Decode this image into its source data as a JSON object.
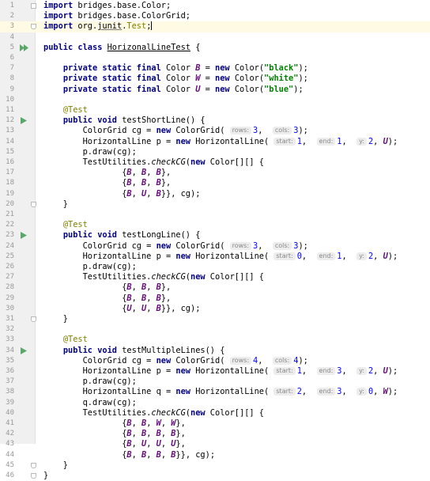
{
  "editor": {
    "language": "java",
    "current_line": 3,
    "colors": {
      "keyword": "#000080",
      "string": "#008000",
      "annotation": "#808000",
      "field": "#660e7a",
      "number": "#0000ff",
      "line_number": "#999999",
      "gutter_bg": "#f0f0f0",
      "current_line_bg": "#fffae3",
      "run_icon": "#59a869"
    },
    "lines": [
      {
        "n": "1",
        "icon": "fold",
        "tokens": [
          {
            "t": "import",
            "c": "kw"
          },
          {
            "t": " bridges.base.Color;"
          }
        ]
      },
      {
        "n": "2",
        "tokens": [
          {
            "t": "import",
            "c": "kw"
          },
          {
            "t": " bridges.base.ColorGrid;"
          }
        ]
      },
      {
        "n": "3",
        "icon": "fold-end",
        "tokens": [
          {
            "t": "import",
            "c": "kw"
          },
          {
            "t": " org."
          },
          {
            "t": "junit",
            "c": "junit-u"
          },
          {
            "t": "."
          },
          {
            "t": "Test",
            "c": "ann"
          },
          {
            "t": ";"
          }
        ]
      },
      {
        "n": "4",
        "tokens": []
      },
      {
        "n": "5",
        "icon": "run-double",
        "tokens": [
          {
            "t": "public class",
            "c": "kw"
          },
          {
            "t": " "
          },
          {
            "t": "HorizonalLineTest",
            "c": "cls-u"
          },
          {
            "t": " {"
          }
        ]
      },
      {
        "n": "6",
        "tokens": []
      },
      {
        "n": "7",
        "tokens": [
          {
            "t": "    "
          },
          {
            "t": "private static final",
            "c": "kw"
          },
          {
            "t": " Color "
          },
          {
            "t": "B",
            "c": "fld"
          },
          {
            "t": " = "
          },
          {
            "t": "new",
            "c": "kw"
          },
          {
            "t": " Color("
          },
          {
            "t": "\"black\"",
            "c": "str"
          },
          {
            "t": ");"
          }
        ]
      },
      {
        "n": "8",
        "tokens": [
          {
            "t": "    "
          },
          {
            "t": "private static final",
            "c": "kw"
          },
          {
            "t": " Color "
          },
          {
            "t": "W",
            "c": "fld"
          },
          {
            "t": " = "
          },
          {
            "t": "new",
            "c": "kw"
          },
          {
            "t": " Color("
          },
          {
            "t": "\"white\"",
            "c": "str"
          },
          {
            "t": ");"
          }
        ]
      },
      {
        "n": "9",
        "tokens": [
          {
            "t": "    "
          },
          {
            "t": "private static final",
            "c": "kw"
          },
          {
            "t": " Color "
          },
          {
            "t": "U",
            "c": "fld"
          },
          {
            "t": " = "
          },
          {
            "t": "new",
            "c": "kw"
          },
          {
            "t": " Color("
          },
          {
            "t": "\"blue\"",
            "c": "str"
          },
          {
            "t": ");"
          }
        ]
      },
      {
        "n": "10",
        "tokens": []
      },
      {
        "n": "11",
        "tokens": [
          {
            "t": "    "
          },
          {
            "t": "@Test",
            "c": "ann"
          }
        ]
      },
      {
        "n": "12",
        "icon": "run",
        "tokens": [
          {
            "t": "    "
          },
          {
            "t": "public void",
            "c": "kw"
          },
          {
            "t": " testShortLine() {"
          }
        ]
      },
      {
        "n": "13",
        "tokens": [
          {
            "t": "        ColorGrid cg = "
          },
          {
            "t": "new",
            "c": "kw"
          },
          {
            "t": " ColorGrid( "
          },
          {
            "t": "rows:",
            "c": "hint"
          },
          {
            "t": "3",
            "c": "num"
          },
          {
            "t": ",  "
          },
          {
            "t": "cols:",
            "c": "hint"
          },
          {
            "t": "3",
            "c": "num"
          },
          {
            "t": ");"
          }
        ]
      },
      {
        "n": "14",
        "tokens": [
          {
            "t": "        HorizontalLine p = "
          },
          {
            "t": "new",
            "c": "kw"
          },
          {
            "t": " HorizontalLine( "
          },
          {
            "t": "start:",
            "c": "hint"
          },
          {
            "t": "1",
            "c": "num"
          },
          {
            "t": ",  "
          },
          {
            "t": "end:",
            "c": "hint"
          },
          {
            "t": "1",
            "c": "num"
          },
          {
            "t": ",  "
          },
          {
            "t": "y:",
            "c": "hint"
          },
          {
            "t": "2",
            "c": "num"
          },
          {
            "t": ", "
          },
          {
            "t": "U",
            "c": "fld"
          },
          {
            "t": ");"
          }
        ]
      },
      {
        "n": "15",
        "tokens": [
          {
            "t": "        p.draw(cg);"
          }
        ]
      },
      {
        "n": "16",
        "tokens": [
          {
            "t": "        TestUtilities."
          },
          {
            "t": "checkCG",
            "c": "stm"
          },
          {
            "t": "("
          },
          {
            "t": "new",
            "c": "kw"
          },
          {
            "t": " Color[][] {"
          }
        ]
      },
      {
        "n": "17",
        "tokens": [
          {
            "t": "                {"
          },
          {
            "t": "B",
            "c": "fld"
          },
          {
            "t": ", "
          },
          {
            "t": "B",
            "c": "fld"
          },
          {
            "t": ", "
          },
          {
            "t": "B",
            "c": "fld"
          },
          {
            "t": "},"
          }
        ]
      },
      {
        "n": "18",
        "tokens": [
          {
            "t": "                {"
          },
          {
            "t": "B",
            "c": "fld"
          },
          {
            "t": ", "
          },
          {
            "t": "B",
            "c": "fld"
          },
          {
            "t": ", "
          },
          {
            "t": "B",
            "c": "fld"
          },
          {
            "t": "},"
          }
        ]
      },
      {
        "n": "19",
        "tokens": [
          {
            "t": "                {"
          },
          {
            "t": "B",
            "c": "fld"
          },
          {
            "t": ", "
          },
          {
            "t": "U",
            "c": "fld"
          },
          {
            "t": ", "
          },
          {
            "t": "B",
            "c": "fld"
          },
          {
            "t": "}}, cg);"
          }
        ]
      },
      {
        "n": "20",
        "icon": "fold-end",
        "tokens": [
          {
            "t": "    }"
          }
        ]
      },
      {
        "n": "21",
        "tokens": []
      },
      {
        "n": "22",
        "tokens": [
          {
            "t": "    "
          },
          {
            "t": "@Test",
            "c": "ann"
          }
        ]
      },
      {
        "n": "23",
        "icon": "run",
        "tokens": [
          {
            "t": "    "
          },
          {
            "t": "public void",
            "c": "kw"
          },
          {
            "t": " testLongLine() {"
          }
        ]
      },
      {
        "n": "24",
        "tokens": [
          {
            "t": "        ColorGrid cg = "
          },
          {
            "t": "new",
            "c": "kw"
          },
          {
            "t": " ColorGrid( "
          },
          {
            "t": "rows:",
            "c": "hint"
          },
          {
            "t": "3",
            "c": "num"
          },
          {
            "t": ",  "
          },
          {
            "t": "cols:",
            "c": "hint"
          },
          {
            "t": "3",
            "c": "num"
          },
          {
            "t": ");"
          }
        ]
      },
      {
        "n": "25",
        "tokens": [
          {
            "t": "        HorizontalLine p = "
          },
          {
            "t": "new",
            "c": "kw"
          },
          {
            "t": " HorizontalLine( "
          },
          {
            "t": "start:",
            "c": "hint"
          },
          {
            "t": "0",
            "c": "num"
          },
          {
            "t": ",  "
          },
          {
            "t": "end:",
            "c": "hint"
          },
          {
            "t": "1",
            "c": "num"
          },
          {
            "t": ",  "
          },
          {
            "t": "y:",
            "c": "hint"
          },
          {
            "t": "2",
            "c": "num"
          },
          {
            "t": ", "
          },
          {
            "t": "U",
            "c": "fld"
          },
          {
            "t": ");"
          }
        ]
      },
      {
        "n": "26",
        "tokens": [
          {
            "t": "        p.draw(cg);"
          }
        ]
      },
      {
        "n": "27",
        "tokens": [
          {
            "t": "        TestUtilities."
          },
          {
            "t": "checkCG",
            "c": "stm"
          },
          {
            "t": "("
          },
          {
            "t": "new",
            "c": "kw"
          },
          {
            "t": " Color[][] {"
          }
        ]
      },
      {
        "n": "28",
        "tokens": [
          {
            "t": "                {"
          },
          {
            "t": "B",
            "c": "fld"
          },
          {
            "t": ", "
          },
          {
            "t": "B",
            "c": "fld"
          },
          {
            "t": ", "
          },
          {
            "t": "B",
            "c": "fld"
          },
          {
            "t": "},"
          }
        ]
      },
      {
        "n": "29",
        "tokens": [
          {
            "t": "                {"
          },
          {
            "t": "B",
            "c": "fld"
          },
          {
            "t": ", "
          },
          {
            "t": "B",
            "c": "fld"
          },
          {
            "t": ", "
          },
          {
            "t": "B",
            "c": "fld"
          },
          {
            "t": "},"
          }
        ]
      },
      {
        "n": "30",
        "tokens": [
          {
            "t": "                {"
          },
          {
            "t": "U",
            "c": "fld"
          },
          {
            "t": ", "
          },
          {
            "t": "U",
            "c": "fld"
          },
          {
            "t": ", "
          },
          {
            "t": "B",
            "c": "fld"
          },
          {
            "t": "}}, cg);"
          }
        ]
      },
      {
        "n": "31",
        "icon": "fold-end",
        "tokens": [
          {
            "t": "    }"
          }
        ]
      },
      {
        "n": "32",
        "tokens": []
      },
      {
        "n": "33",
        "tokens": [
          {
            "t": "    "
          },
          {
            "t": "@Test",
            "c": "ann"
          }
        ]
      },
      {
        "n": "34",
        "icon": "run",
        "tokens": [
          {
            "t": "    "
          },
          {
            "t": "public void",
            "c": "kw"
          },
          {
            "t": " testMultipleLines() {"
          }
        ]
      },
      {
        "n": "35",
        "tokens": [
          {
            "t": "        ColorGrid cg = "
          },
          {
            "t": "new",
            "c": "kw"
          },
          {
            "t": " ColorGrid( "
          },
          {
            "t": "rows:",
            "c": "hint"
          },
          {
            "t": "4",
            "c": "num"
          },
          {
            "t": ",  "
          },
          {
            "t": "cols:",
            "c": "hint"
          },
          {
            "t": "4",
            "c": "num"
          },
          {
            "t": ");"
          }
        ]
      },
      {
        "n": "36",
        "tokens": [
          {
            "t": "        HorizontalLine p = "
          },
          {
            "t": "new",
            "c": "kw"
          },
          {
            "t": " HorizontalLine( "
          },
          {
            "t": "start:",
            "c": "hint"
          },
          {
            "t": "1",
            "c": "num"
          },
          {
            "t": ",  "
          },
          {
            "t": "end:",
            "c": "hint"
          },
          {
            "t": "3",
            "c": "num"
          },
          {
            "t": ",  "
          },
          {
            "t": "y:",
            "c": "hint"
          },
          {
            "t": "2",
            "c": "num"
          },
          {
            "t": ", "
          },
          {
            "t": "U",
            "c": "fld"
          },
          {
            "t": ");"
          }
        ]
      },
      {
        "n": "37",
        "tokens": [
          {
            "t": "        p.draw(cg);"
          }
        ]
      },
      {
        "n": "38",
        "tokens": [
          {
            "t": "        HorizontalLine q = "
          },
          {
            "t": "new",
            "c": "kw"
          },
          {
            "t": " HorizontalLine( "
          },
          {
            "t": "start:",
            "c": "hint"
          },
          {
            "t": "2",
            "c": "num"
          },
          {
            "t": ",  "
          },
          {
            "t": "end:",
            "c": "hint"
          },
          {
            "t": "3",
            "c": "num"
          },
          {
            "t": ",  "
          },
          {
            "t": "y:",
            "c": "hint"
          },
          {
            "t": "0",
            "c": "num"
          },
          {
            "t": ", "
          },
          {
            "t": "W",
            "c": "fld"
          },
          {
            "t": ");"
          }
        ]
      },
      {
        "n": "39",
        "tokens": [
          {
            "t": "        q.draw(cg);"
          }
        ]
      },
      {
        "n": "40",
        "tokens": [
          {
            "t": "        TestUtilities."
          },
          {
            "t": "checkCG",
            "c": "stm"
          },
          {
            "t": "("
          },
          {
            "t": "new",
            "c": "kw"
          },
          {
            "t": " Color[][] {"
          }
        ]
      },
      {
        "n": "41",
        "tokens": [
          {
            "t": "                {"
          },
          {
            "t": "B",
            "c": "fld"
          },
          {
            "t": ", "
          },
          {
            "t": "B",
            "c": "fld"
          },
          {
            "t": ", "
          },
          {
            "t": "W",
            "c": "fld"
          },
          {
            "t": ", "
          },
          {
            "t": "W",
            "c": "fld"
          },
          {
            "t": "},"
          }
        ]
      },
      {
        "n": "42",
        "tokens": [
          {
            "t": "                {"
          },
          {
            "t": "B",
            "c": "fld"
          },
          {
            "t": ", "
          },
          {
            "t": "B",
            "c": "fld"
          },
          {
            "t": ", "
          },
          {
            "t": "B",
            "c": "fld"
          },
          {
            "t": ", "
          },
          {
            "t": "B",
            "c": "fld"
          },
          {
            "t": "},"
          }
        ]
      },
      {
        "n": "43",
        "tokens": [
          {
            "t": "                {"
          },
          {
            "t": "B",
            "c": "fld"
          },
          {
            "t": ", "
          },
          {
            "t": "U",
            "c": "fld"
          },
          {
            "t": ", "
          },
          {
            "t": "U",
            "c": "fld"
          },
          {
            "t": ", "
          },
          {
            "t": "U",
            "c": "fld"
          },
          {
            "t": "},"
          }
        ]
      },
      {
        "n": "44",
        "tokens": [
          {
            "t": "                {"
          },
          {
            "t": "B",
            "c": "fld"
          },
          {
            "t": ", "
          },
          {
            "t": "B",
            "c": "fld"
          },
          {
            "t": ", "
          },
          {
            "t": "B",
            "c": "fld"
          },
          {
            "t": ", "
          },
          {
            "t": "B",
            "c": "fld"
          },
          {
            "t": "}}, cg);"
          }
        ]
      },
      {
        "n": "45",
        "icon": "fold-end",
        "tokens": [
          {
            "t": "    }"
          }
        ]
      },
      {
        "n": "46",
        "icon": "fold-end",
        "tokens": [
          {
            "t": "}"
          }
        ]
      }
    ]
  }
}
